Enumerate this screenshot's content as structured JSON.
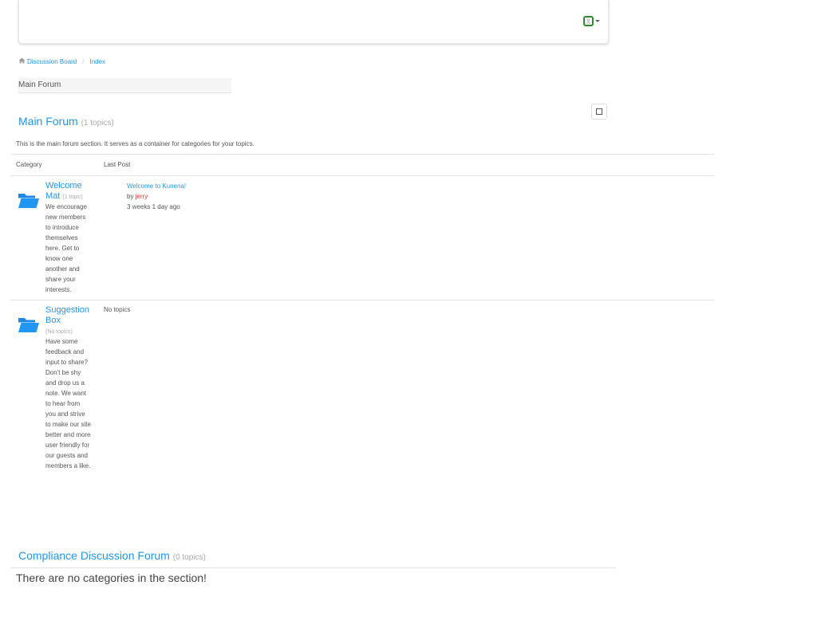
{
  "breadcrumb": {
    "home_label": "Discussion Board",
    "separator": "/",
    "current": "Index"
  },
  "section_tab": {
    "label": "Main Forum"
  },
  "main_section": {
    "title": "Main Forum",
    "count": "(1 topics)",
    "description": "This is the main forum section. It serves as a container for categories for your topics.",
    "columns": {
      "category": "Category",
      "last_post": "Last Post"
    },
    "categories": [
      {
        "title_line1": "Welcome",
        "title_line2": "Mat",
        "count": "(1 topic)",
        "description": "We encourage new members to introduce themselves here. Get to know one another and share your interests.",
        "last_post": {
          "title": "Welcome to Kunena!",
          "by": "by",
          "author": "jerry",
          "time": "3 weeks 1 day ago"
        }
      },
      {
        "title_line1": "Suggestion",
        "title_line2": "Box",
        "count": "(No topics)",
        "description": "Have some feedback and input to share? Don't be shy and drop us a note. We want to hear from you and strive to make our site better and more user friendly for our guests and members a like.",
        "no_topics": "No topics"
      }
    ]
  },
  "compliance_section": {
    "title": "Compliance Discussion Forum",
    "count": "(0 topics)",
    "empty_message": "There are no categories in the section!"
  },
  "colors": {
    "link": "#2196f3",
    "author": "#e53935",
    "user_border": "#2e8b2e"
  },
  "icons": {
    "home": "home-icon",
    "user": "user-icon",
    "folder": "folder-open-icon"
  }
}
